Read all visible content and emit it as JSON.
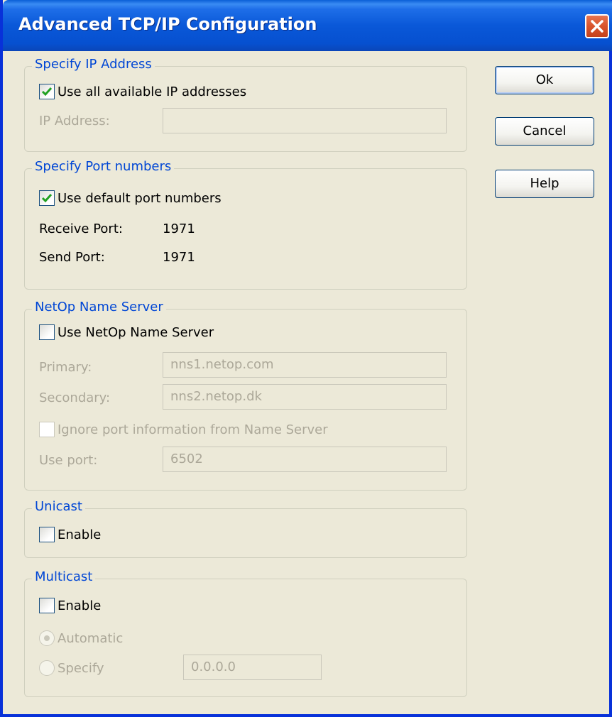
{
  "window": {
    "title": "Advanced TCP/IP Configuration"
  },
  "buttons": {
    "ok": "Ok",
    "cancel": "Cancel",
    "help": "Help"
  },
  "ip_group": {
    "legend": "Specify IP Address",
    "use_all_label": "Use all available IP addresses",
    "use_all_checked": true,
    "ip_label": "IP Address:",
    "ip_value": ""
  },
  "port_group": {
    "legend": "Specify Port numbers",
    "use_default_label": "Use default port numbers",
    "use_default_checked": true,
    "receive_label": "Receive Port:",
    "receive_value": "1971",
    "send_label": "Send Port:",
    "send_value": "1971"
  },
  "nameserver_group": {
    "legend": "NetOp Name Server",
    "use_ns_label": "Use NetOp Name Server",
    "use_ns_checked": false,
    "primary_label": "Primary:",
    "primary_value": "nns1.netop.com",
    "secondary_label": "Secondary:",
    "secondary_value": "nns2.netop.dk",
    "ignore_label": "Ignore port information from Name Server",
    "ignore_checked": false,
    "use_port_label": "Use port:",
    "use_port_value": "6502"
  },
  "unicast_group": {
    "legend": "Unicast",
    "enable_label": "Enable",
    "enable_checked": false
  },
  "multicast_group": {
    "legend": "Multicast",
    "enable_label": "Enable",
    "enable_checked": false,
    "automatic_label": "Automatic",
    "automatic_selected": true,
    "specify_label": "Specify",
    "specify_value": "0.0.0.0"
  },
  "colors": {
    "titlebar": "#0a58d8",
    "dialog_bg": "#ece9d8",
    "legend_text": "#0046d5",
    "disabled_text": "#aca899",
    "check_mark": "#21a121",
    "close_button": "#d9542c"
  },
  "icons": {
    "close": "close-x-icon",
    "check": "checkmark-icon"
  }
}
